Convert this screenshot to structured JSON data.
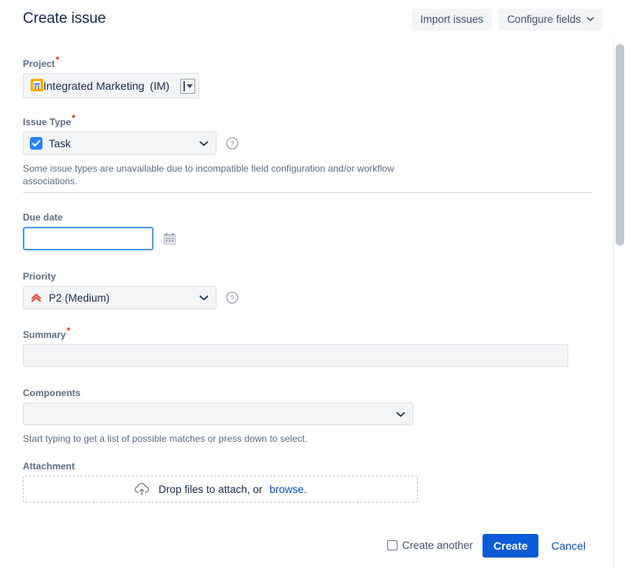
{
  "header": {
    "title": "Create issue",
    "import_label": "Import issues",
    "configure_label": "Configure fields"
  },
  "colors": {
    "primary_button": "#0c5bd6",
    "link": "#0052cc",
    "required_asterisk": "#de350b",
    "label": "#5e6c84",
    "title": "#172b4d",
    "focus_border": "#4c9aff",
    "project_icon_bg": "#ffab00",
    "issue_type_icon_bg": "#2684ff",
    "priority_icon": "#e5493a",
    "field_bg": "#f4f5f7",
    "field_border": "#dfe1e6"
  },
  "fields": {
    "project": {
      "label": "Project",
      "required": true,
      "value": "Integrated Marketing",
      "key": "(IM)",
      "icon": "project-avatar-icon"
    },
    "issue_type": {
      "label": "Issue Type",
      "required": true,
      "value": "Task",
      "icon": "task-check-icon",
      "help_icon": "question-circle-icon",
      "description": "Some issue types are unavailable due to incompatible field configuration and/or workflow associations."
    },
    "due_date": {
      "label": "Due date",
      "required": false,
      "value": "",
      "placeholder": "",
      "focused": true,
      "picker_icon": "calendar-icon"
    },
    "priority": {
      "label": "Priority",
      "required": false,
      "value": "P2 (Medium)",
      "icon": "priority-medium-icon",
      "help_icon": "question-circle-icon"
    },
    "summary": {
      "label": "Summary",
      "required": true,
      "value": "",
      "placeholder": ""
    },
    "components": {
      "label": "Components",
      "required": false,
      "value": "",
      "placeholder": "",
      "description": "Start typing to get a list of possible matches or press down to select."
    },
    "attachment": {
      "label": "Attachment",
      "required": false,
      "drop_text": "Drop files to attach, or",
      "browse_label": "browse.",
      "icon": "cloud-upload-icon"
    }
  },
  "footer": {
    "create_another_label": "Create another",
    "create_another_checked": false,
    "create_label": "Create",
    "cancel_label": "Cancel"
  }
}
